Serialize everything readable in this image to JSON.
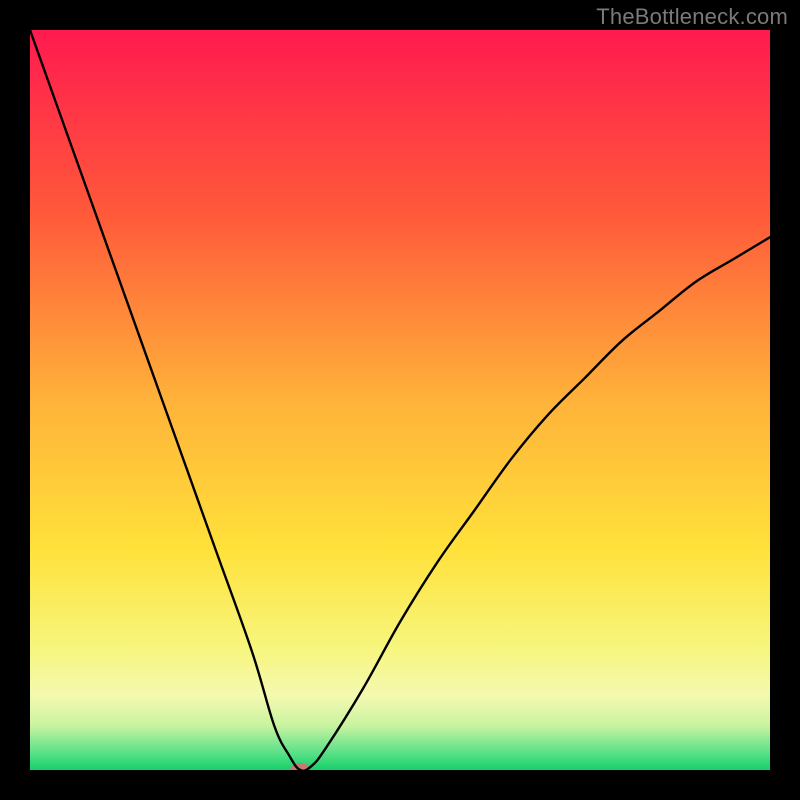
{
  "watermark": "TheBottleneck.com",
  "chart_data": {
    "type": "line",
    "title": "",
    "xlabel": "",
    "ylabel": "",
    "xlim": [
      0,
      100
    ],
    "ylim": [
      0,
      100
    ],
    "grid": false,
    "series": [
      {
        "name": "bottleneck-curve",
        "note": "V-shaped curve; left branch near-linear steep descent, right branch convex rising",
        "x": [
          0,
          5,
          10,
          15,
          20,
          25,
          30,
          33,
          35,
          36.5,
          38,
          40,
          45,
          50,
          55,
          60,
          65,
          70,
          75,
          80,
          85,
          90,
          95,
          100
        ],
        "y": [
          100,
          86,
          72,
          58,
          44,
          30,
          16,
          6,
          2,
          0,
          0.5,
          3,
          11,
          20,
          28,
          35,
          42,
          48,
          53,
          58,
          62,
          66,
          69,
          72
        ]
      }
    ],
    "background_gradient": {
      "stops": [
        {
          "offset": 0.0,
          "color": "#ff1a4f"
        },
        {
          "offset": 0.25,
          "color": "#ff5a3a"
        },
        {
          "offset": 0.5,
          "color": "#ffb23a"
        },
        {
          "offset": 0.7,
          "color": "#ffe13a"
        },
        {
          "offset": 0.83,
          "color": "#f7f57a"
        },
        {
          "offset": 0.9,
          "color": "#f4f9b0"
        },
        {
          "offset": 0.94,
          "color": "#c9f3a0"
        },
        {
          "offset": 0.975,
          "color": "#5fe28a"
        },
        {
          "offset": 1.0,
          "color": "#17d06a"
        }
      ]
    },
    "marker": {
      "name": "optimal-point",
      "x": 36.5,
      "y": 0,
      "color": "#c77a72",
      "rx": 10,
      "ry": 7
    }
  }
}
